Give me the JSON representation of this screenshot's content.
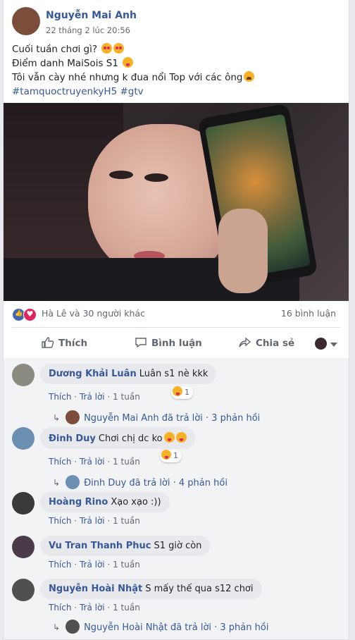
{
  "post": {
    "author": "Nguyễn Mai Anh",
    "timestamp": "22 tháng 2 lúc 20:56",
    "lines": [
      "Cuối tuần chơi gì?",
      "Điểm danh MaiSois S1",
      "Tôi vẫn cày nhé nhưng k đua nổi Top với các ông"
    ],
    "hashtags": "#tamquoctruyenkyH5 #gtv"
  },
  "reactions": {
    "summary": "Hà Lê và 30 người khác",
    "comments_count": "16 bình luận"
  },
  "actions": {
    "like": "Thích",
    "comment": "Bình luận",
    "share": "Chia sẻ"
  },
  "comments": [
    {
      "author": "Dương Khải Luân",
      "text": "Luân s1 nè kkk",
      "like": "Thích",
      "reply": "Trả lời",
      "time": "1 tuần",
      "reaction_count": "1",
      "replies": "Nguyễn Mai Anh đã trả lời · 3 phản hồi"
    },
    {
      "author": "Đinh Duy",
      "text": "Chơi chị dc ko",
      "like": "Thích",
      "reply": "Trả lời",
      "time": "1 tuần",
      "reaction_count": "1",
      "replies": "Đinh Duy đã trả lời · 4 phản hồi"
    },
    {
      "author": "Hoàng Rino",
      "text": "Xạo xạo :))",
      "like": "Thích",
      "reply": "Trả lời",
      "time": "1 tuần"
    },
    {
      "author": "Vu Tran Thanh Phuc",
      "text": "S1 giờ còn",
      "like": "Thích",
      "reply": "Trả lời",
      "time": "1 tuần"
    },
    {
      "author": "Nguyễn Hoài Nhật",
      "text": "S mấy thế qua s12 chơi",
      "like": "Thích",
      "reply": "Trả lời",
      "time": "1 tuần",
      "replies": "Nguyễn Hoài Nhật đã trả lời · 3 phản hồi"
    }
  ],
  "colors": {
    "link": "#385898",
    "like_blue": "#4267b2",
    "love_red": "#e0245e",
    "bg": "#e9ebee"
  }
}
